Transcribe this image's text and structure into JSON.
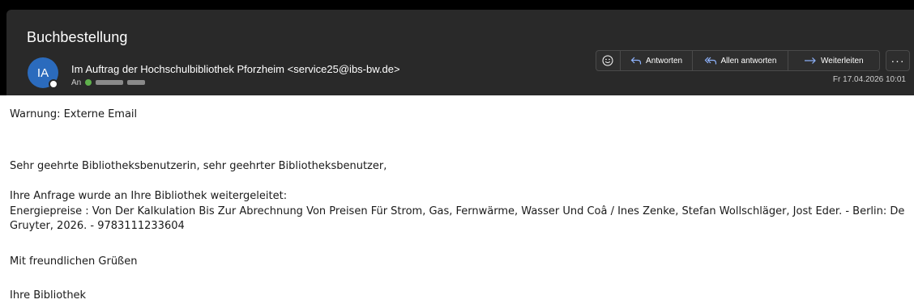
{
  "email": {
    "subject": "Buchbestellung",
    "avatar_initials": "IA",
    "sender": "Im Auftrag der Hochschulbibliothek Pforzheim <service25@ibs-bw.de>",
    "to_label": "An",
    "date": "Fr 17.04.2026 10:01"
  },
  "actions": {
    "reply_label": "Antworten",
    "reply_all_label": "Allen antworten",
    "forward_label": "Weiterleiten",
    "more_label": "···"
  },
  "icons": {
    "emoji": "smiley-icon",
    "reply": "reply-arrow-icon",
    "reply_all": "reply-all-icon",
    "forward": "forward-arrow-icon",
    "more": "more-icon"
  },
  "body": {
    "warning": "Warnung: Externe Email",
    "greeting": "Sehr geehrte Bibliotheksbenutzerin, sehr geehrter Bibliotheksbenutzer,",
    "line1": "Ihre Anfrage wurde an Ihre Bibliothek weitergeleitet:",
    "book": "Energiepreise : Von Der Kalkulation Bis Zur Abrechnung Von Preisen Für Strom, Gas, Fernwärme, Wasser Und Coâ / Ines Zenke, Stefan Wollschläger, Jost Eder. - Berlin: De Gruyter, 2026. - 9783111233604",
    "closing": "Mit freundlichen Grüßen",
    "signature": "Ihre Bibliothek"
  },
  "colors": {
    "header_bg": "#292929",
    "avatar_bg": "#2b6bbd",
    "accent": "#8fb4ff",
    "verified": "#5fb14c"
  }
}
